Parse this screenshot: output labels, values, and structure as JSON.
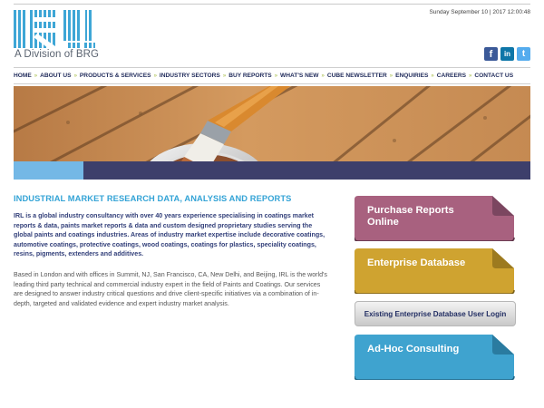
{
  "header": {
    "logo_tagline": "A Division of BRG",
    "datetime": "Sunday September 10 | 2017 12:00:48"
  },
  "social": [
    {
      "name": "facebook",
      "glyph": "f",
      "icon": "facebook-icon",
      "color": "#3b5998"
    },
    {
      "name": "linkedin",
      "glyph": "in",
      "icon": "linkedin-icon",
      "color": "#0e76a8"
    },
    {
      "name": "twitter",
      "glyph": "t",
      "icon": "twitter-icon",
      "color": "#55acee"
    }
  ],
  "nav": {
    "items": [
      "HOME",
      "ABOUT US",
      "PRODUCTS & SERVICES",
      "INDUSTRY SECTORS",
      "BUY REPORTS",
      "WHAT'S NEW",
      "CUBE NEWSLETTER",
      "ENQUIRIES",
      "CAREERS",
      "CONTACT US"
    ],
    "separator": "»"
  },
  "main": {
    "heading": "INDUSTRIAL MARKET RESEARCH DATA, ANALYSIS AND REPORTS",
    "lead": "IRL is a global industry consultancy with over 40 years experience specialising in coatings market reports & data, paints market reports & data and custom designed proprietary studies serving the global paints and coatings industries. Areas of industry market expertise include decorative coatings, automotive coatings, protective coatings, wood coatings, coatings for plastics, speciality coatings, resins, pigments, extenders and additives.",
    "body": "Based in London and with offices in Summit, NJ, San Francisco, CA, New Delhi, and Beijing, IRL is the world's leading third party technical and commercial industry expert in the field of Paints and Coatings. Our services are designed to answer industry critical questions and drive client-specific initiatives via a combination of in-depth, targeted and validated evidence and expert industry market analysis."
  },
  "sidebar": {
    "purchase": {
      "label": "Purchase Reports Online",
      "color": "#a8617f"
    },
    "enterprise": {
      "label": "Enterprise Database",
      "color": "#cfa330"
    },
    "login": {
      "label": "Existing Enterprise Database User Login"
    },
    "adhoc": {
      "label": "Ad-Hoc Consulting",
      "color": "#3fa3cf"
    }
  },
  "colors": {
    "brand_navy": "#1f2a5a",
    "accent_blue": "#33a3d6",
    "nav_separator": "#a2b93c"
  }
}
